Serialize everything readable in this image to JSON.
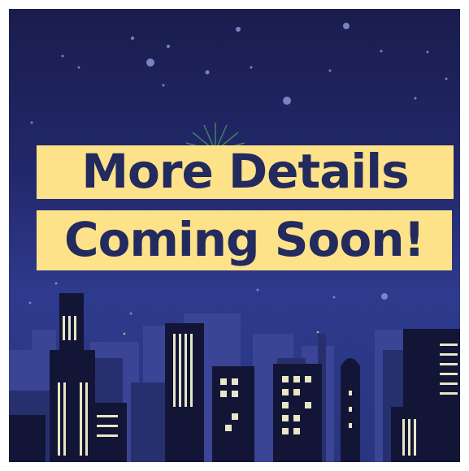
{
  "headline": {
    "line1": "More Details",
    "line2": "Coming Soon!"
  },
  "colors": {
    "sky_top": "#1a1d4c",
    "sky_bottom": "#2e3a8c",
    "banner": "#fde28a",
    "text": "#222a5e",
    "window_light": "#e8e6c4"
  }
}
